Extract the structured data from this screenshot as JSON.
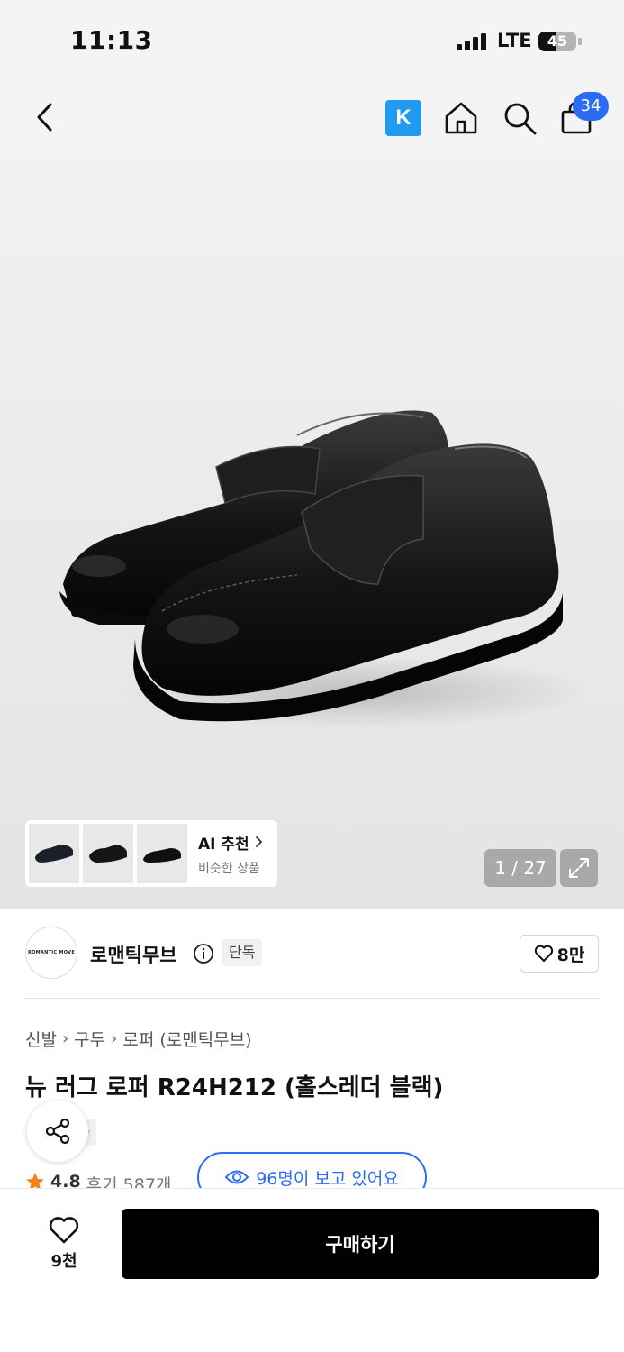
{
  "status_bar": {
    "time": "11:13",
    "network": "LTE",
    "battery": "45",
    "battery_level": 0.45
  },
  "nav": {
    "back_icon": "chevron-left-icon",
    "k_label": "K",
    "home_icon": "home-icon",
    "search_icon": "search-icon",
    "cart_icon": "shopping-bag-icon",
    "cart_count": "34",
    "accent_color": "#2b6cf3",
    "k_color": "#1f9bf2"
  },
  "gallery": {
    "ai_title": "AI 추천",
    "ai_subtitle": "비슷한 상품",
    "pager": "1 / 27",
    "expand_icon": "expand-icon"
  },
  "brand": {
    "logo_text": "ROMANTIC MOVE",
    "name": "로맨틱무브",
    "exclusive": "단독",
    "likes": "8만"
  },
  "product": {
    "breadcrumb": [
      "신발",
      "구두",
      "로퍼 (로맨틱무브)"
    ],
    "title": "뉴 러그 로퍼 R24H212 (홀스레더 블랙)",
    "exclusive": "단독",
    "rating": "4.8",
    "reviews": "후기 587개",
    "viewers": "96명이 보고 있어요"
  },
  "bottom_bar": {
    "wish_count": "9천",
    "buy_label": "구매하기"
  }
}
